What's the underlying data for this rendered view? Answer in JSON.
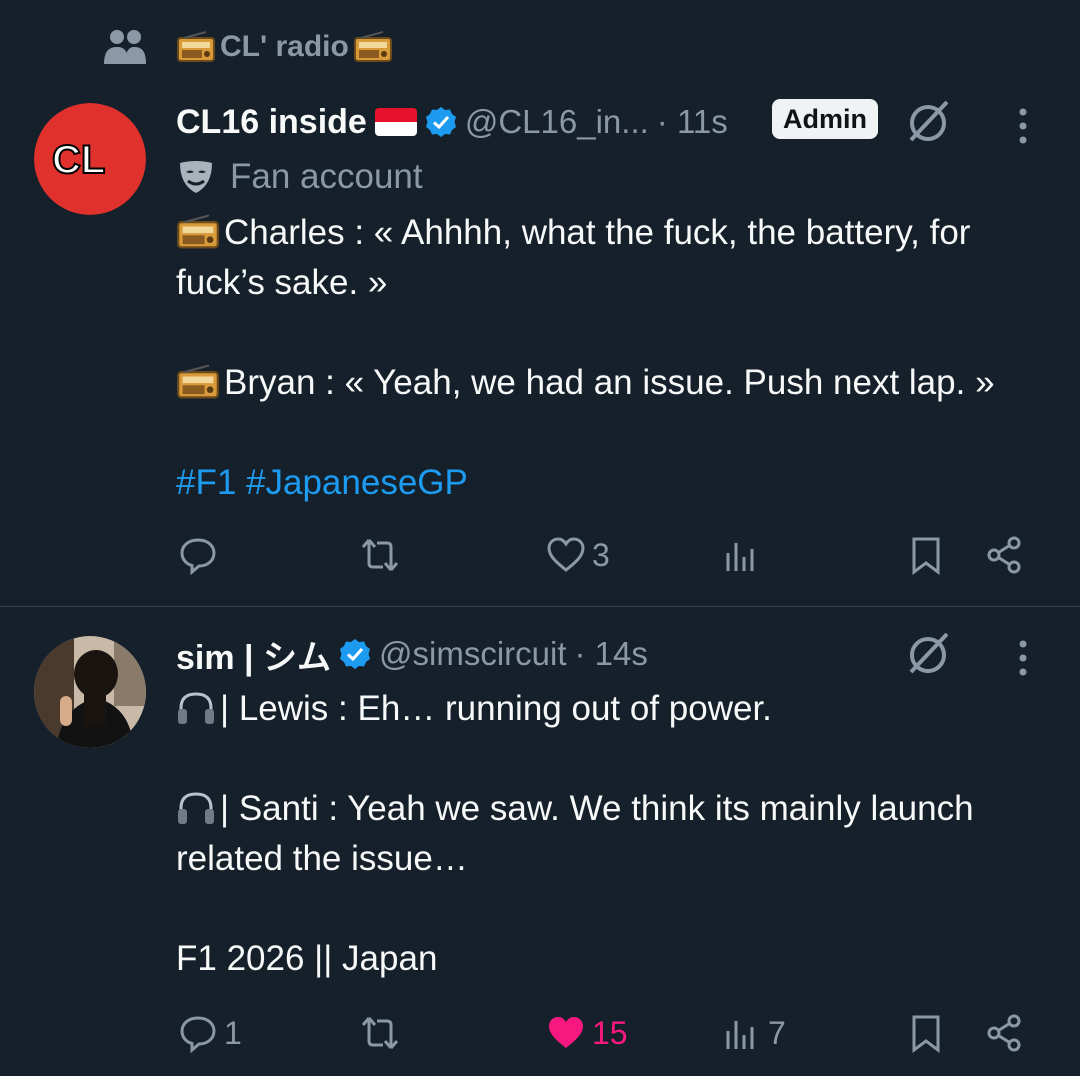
{
  "community": {
    "name": "CL' radio",
    "icon": "people-icon",
    "emoji": "radio"
  },
  "posts": [
    {
      "display_name": "CL16 inside",
      "flag": "monaco-flag",
      "verified": true,
      "handle": "@CL16_in...",
      "time": "· 11s",
      "badge": "Admin",
      "fan_label": "Fan account",
      "avatar_text": "CL",
      "avatar_color": "#e0312d",
      "lines": [
        {
          "icon": "radio",
          "text": "Charles : « Ahhhh, what the fuck, the battery, for fuck’s sake. »"
        },
        {
          "icon": "radio",
          "text": "Bryan : « Yeah, we had an issue. Push next lap. »"
        }
      ],
      "hashtags": "#F1 #JapaneseGP",
      "actions": {
        "replies": "",
        "reposts": "",
        "likes": "3",
        "views": ""
      }
    },
    {
      "display_name": "sim | シム",
      "verified": true,
      "handle": "@simscircuit",
      "time": "· 14s",
      "lines": [
        {
          "icon": "headphones",
          "text": "| Lewis : Eh… running out of power."
        },
        {
          "icon": "headphones",
          "text": "| Santi : Yeah we saw. We think its mainly launch related the issue…"
        },
        {
          "icon": "",
          "text": "F1 2026 || Japan"
        }
      ],
      "actions": {
        "replies": "1",
        "reposts": "",
        "likes": "15",
        "views": "7"
      }
    }
  ],
  "colors": {
    "background": "#15202b",
    "muted": "#8b98a5",
    "link": "#1d9bf0",
    "like": "#f91880",
    "verified": "#1d9bf0"
  }
}
